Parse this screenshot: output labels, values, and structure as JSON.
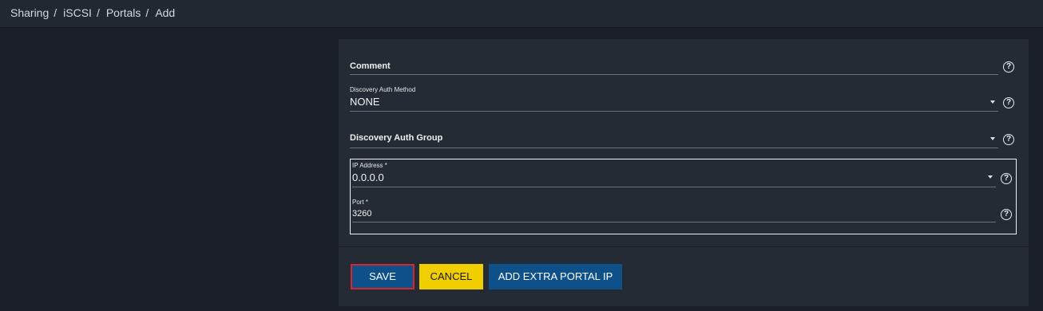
{
  "breadcrumb": [
    "Sharing",
    "iSCSI",
    "Portals",
    "Add"
  ],
  "breadcrumb_separator": "/",
  "form": {
    "comment": {
      "label": "Comment",
      "value": ""
    },
    "discovery_auth_method": {
      "label": "Discovery Auth Method",
      "value": "NONE"
    },
    "discovery_auth_group": {
      "label": "Discovery Auth Group",
      "value": ""
    },
    "ip_address": {
      "label": "IP Address *",
      "value": "0.0.0.0"
    },
    "port": {
      "label": "Port *",
      "value": "3260"
    }
  },
  "help_glyph": "?",
  "buttons": {
    "save": "SAVE",
    "cancel": "CANCEL",
    "add_extra": "ADD EXTRA PORTAL IP"
  },
  "colors": {
    "primary": "#0e5089",
    "warning": "#f0ce00",
    "focus_border": "#d9262e"
  }
}
